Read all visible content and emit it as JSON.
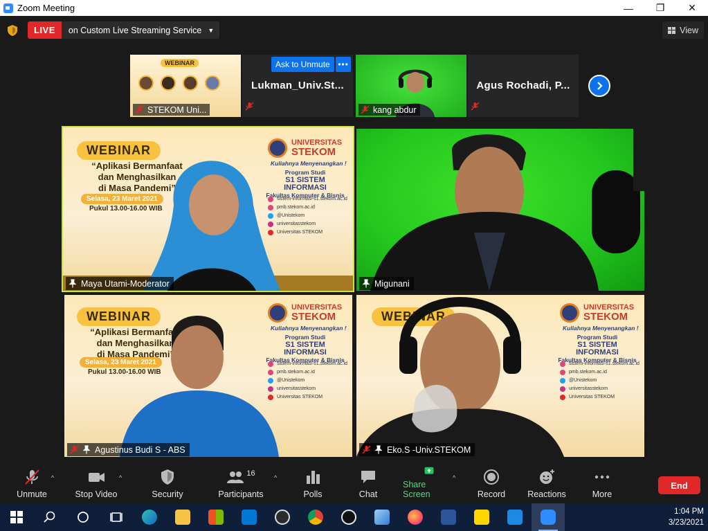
{
  "window": {
    "title": "Zoom Meeting",
    "minimize": "—",
    "maximize": "❐",
    "close": "✕"
  },
  "topbar": {
    "live_label": "LIVE",
    "stream_text": "on Custom Live Streaming Service",
    "view_label": "View"
  },
  "filmstrip": {
    "tiles": [
      {
        "name": "STEKOM Uni...",
        "banner": "WEBINAR"
      },
      {
        "bigname": "Lukman_Univ.St..."
      },
      {
        "name": "kang abdur"
      },
      {
        "bigname": "Agus Rochadi, P..."
      }
    ],
    "ask_to_unmute": "Ask to Unmute",
    "more_dots": "•••"
  },
  "webinar": {
    "badge": "WEBINAR",
    "quote_lines": [
      "“Aplikasi Bermanfaat",
      "dan Menghasilkan",
      "di Masa Pandemi”"
    ],
    "date": "Selasa, 23 Maret 2021",
    "time": "Pukul 13.00-16.00 WIB",
    "uni_small": "UNIVERSITAS",
    "uni_big": "STEKOM",
    "tagline": "Kuliahnya Menyenangkan !",
    "prog_small": "Program Studi",
    "prog_big": "S1 SISTEM INFORMASI",
    "prog_fac": "Fakultas Komputer & Bisnis",
    "socials": [
      "sistem-informasi-s1.stekom.ac.id",
      "pmb.stekom.ac.id",
      "@Unistekom",
      "universitasstekom",
      "Universitas STEKOM"
    ]
  },
  "tiles": {
    "maya": "Maya Utami-Moderator",
    "migunani": "Migunani",
    "agustinus": "Agustinus Budi S - ABS",
    "eko": "Eko.S -Univ.STEKOM"
  },
  "toolbar": {
    "unmute": "Unmute",
    "stop_video": "Stop Video",
    "security": "Security",
    "participants": "Participants",
    "participants_count": "16",
    "polls": "Polls",
    "chat": "Chat",
    "share_screen": "Share Screen",
    "record": "Record",
    "reactions": "Reactions",
    "more": "More",
    "end": "End",
    "caret": "^"
  },
  "clock": {
    "time": "1:04 PM",
    "date": "3/23/2021"
  },
  "colors": {
    "accent": "#0e72ed",
    "live": "#e02828",
    "share": "#22c55e"
  }
}
